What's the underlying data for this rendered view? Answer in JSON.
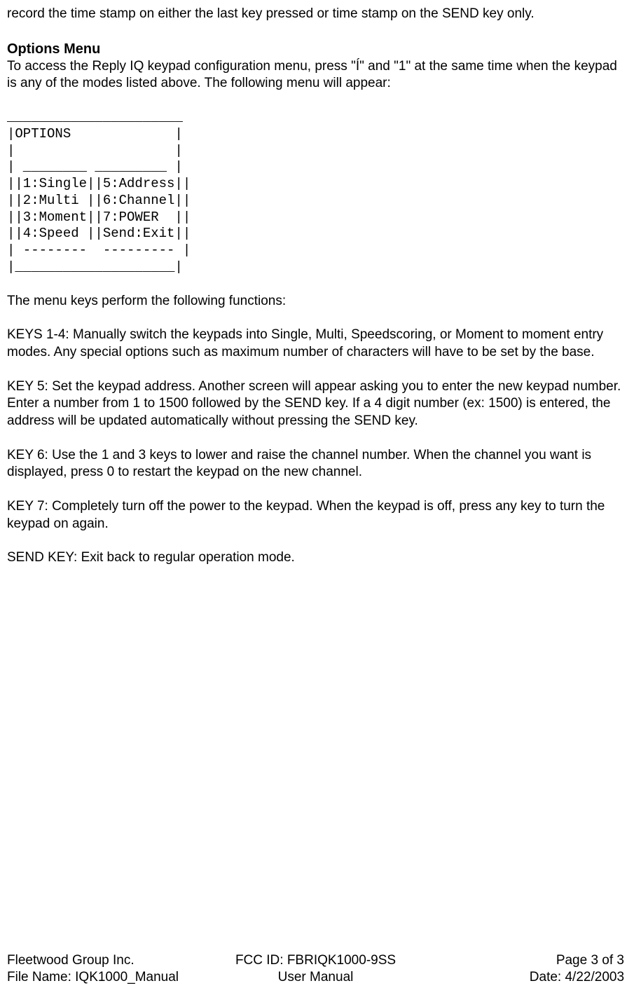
{
  "intro_para": "record the time stamp on either the last key pressed or time stamp on the SEND key only.",
  "heading": "Options Menu",
  "options_intro_a": "To access the Reply IQ keypad configuration menu, press \"",
  "options_intro_arrow": "Í",
  "options_intro_b": "\"  and \"1\" at the same time when the keypad is any of the modes listed above.    The following menu will appear:",
  "ascii_menu": "______________________\n|OPTIONS             |\n|                    |\n| ________ _________ |\n||1:Single||5:Address||\n||2:Multi ||6:Channel||\n||3:Moment||7:POWER  ||\n||4:Speed ||Send:Exit||\n| --------  --------- |\n|____________________|",
  "menu_intro": "The menu keys perform the following functions:",
  "keys_1_4": "KEYS 1-4:  Manually switch the keypads into Single, Multi, Speedscoring, or Moment to moment entry modes.  Any special options such as maximum number of characters will have to be set by the base.",
  "key_5": "KEY 5: Set the keypad address.  Another screen will appear asking you to enter the new keypad number.  Enter a number from 1 to 1500 followed by the SEND key.  If a 4 digit number (ex: 1500) is entered, the address will be updated  automatically without pressing the SEND key.",
  "key_6": "KEY 6: Use the 1 and 3 keys to lower and raise the channel number.  When the channel you want is displayed, press 0 to restart the keypad on the new channel.",
  "key_7": "KEY 7: Completely turn off the power to the keypad.  When the keypad is off, press any key to turn the keypad on again.",
  "send_key": "SEND KEY: Exit back to regular operation mode.",
  "footer": {
    "row1": {
      "left": "Fleetwood Group Inc.",
      "center": "FCC ID:  FBRIQK1000-9SS",
      "right": "Page 3 of 3"
    },
    "row2": {
      "left": "File Name: IQK1000_Manual",
      "center": "User Manual",
      "right": "Date: 4/22/2003"
    }
  }
}
